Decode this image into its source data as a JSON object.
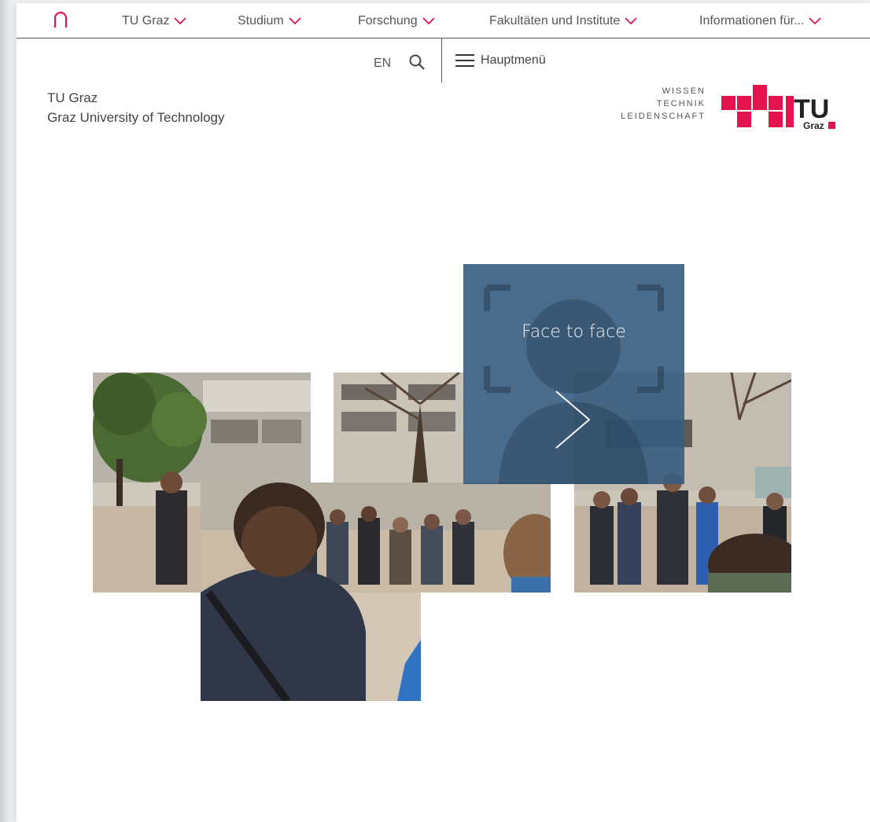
{
  "nav": {
    "home_icon": "home-arch-icon",
    "items": [
      {
        "label": "TU Graz"
      },
      {
        "label": "Studium"
      },
      {
        "label": "Forschung"
      },
      {
        "label": "Fakultäten und Institute"
      },
      {
        "label": "Informationen für..."
      }
    ],
    "accent": "#e4124d"
  },
  "util": {
    "language": "EN",
    "search_icon": "search-icon",
    "menu_label": "Hauptmenü",
    "menu_icon": "hamburger-icon"
  },
  "brand": {
    "line1": "TU Graz",
    "line2": "Graz University of Technology",
    "tagline": [
      "WISSEN",
      "TECHNIK",
      "LEIDENSCHAFT"
    ],
    "logo_text": "TU",
    "logo_sub": "Graz",
    "logo_color": "#e4124d"
  },
  "teaser": {
    "title": "Face to face",
    "arrow_icon": "chevron-right-icon",
    "overlay_color": "#365c80"
  }
}
